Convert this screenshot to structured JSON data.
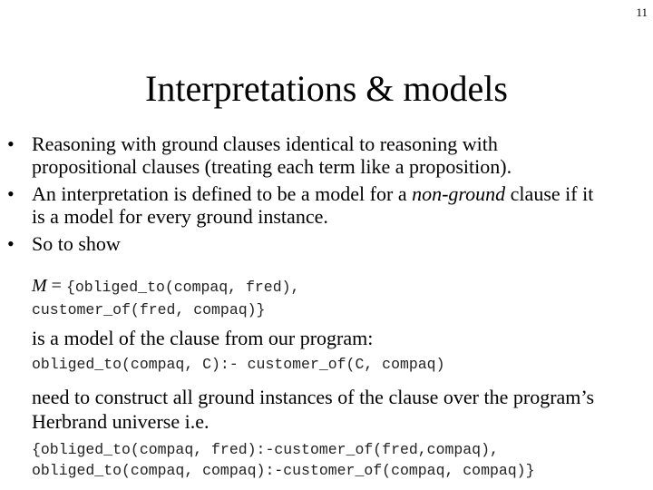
{
  "slide_number": "11",
  "title": "Interpretations & models",
  "bullets": [
    {
      "line1": "Reasoning with ground clauses identical to reasoning with",
      "line2": "propositional clauses (treating each term like a proposition)."
    },
    {
      "pre": "An interpretation is defined to be a model for a ",
      "em": "non-ground",
      "post": " clause if it",
      "line2": "is a model for every ground instance."
    },
    {
      "line1": "So to show"
    }
  ],
  "model_label": "M",
  "model_eq": " = ",
  "model_line1": "{obliged_to(compaq, fred),",
  "model_line2": "customer_of(fred, compaq)}",
  "text_model_of": "is a model of the clause from our program:",
  "clause": "obliged_to(compaq, C):- customer_of(C, compaq)",
  "text_need_line1": "need to construct all ground instances of the clause over the program’s",
  "text_need_line2": "Herbrand universe i.e.",
  "instances_line1": "{obliged_to(compaq, fred):-customer_of(fred,compaq),",
  "instances_line2": "obliged_to(compaq, compaq):-customer_of(compaq, compaq)}"
}
